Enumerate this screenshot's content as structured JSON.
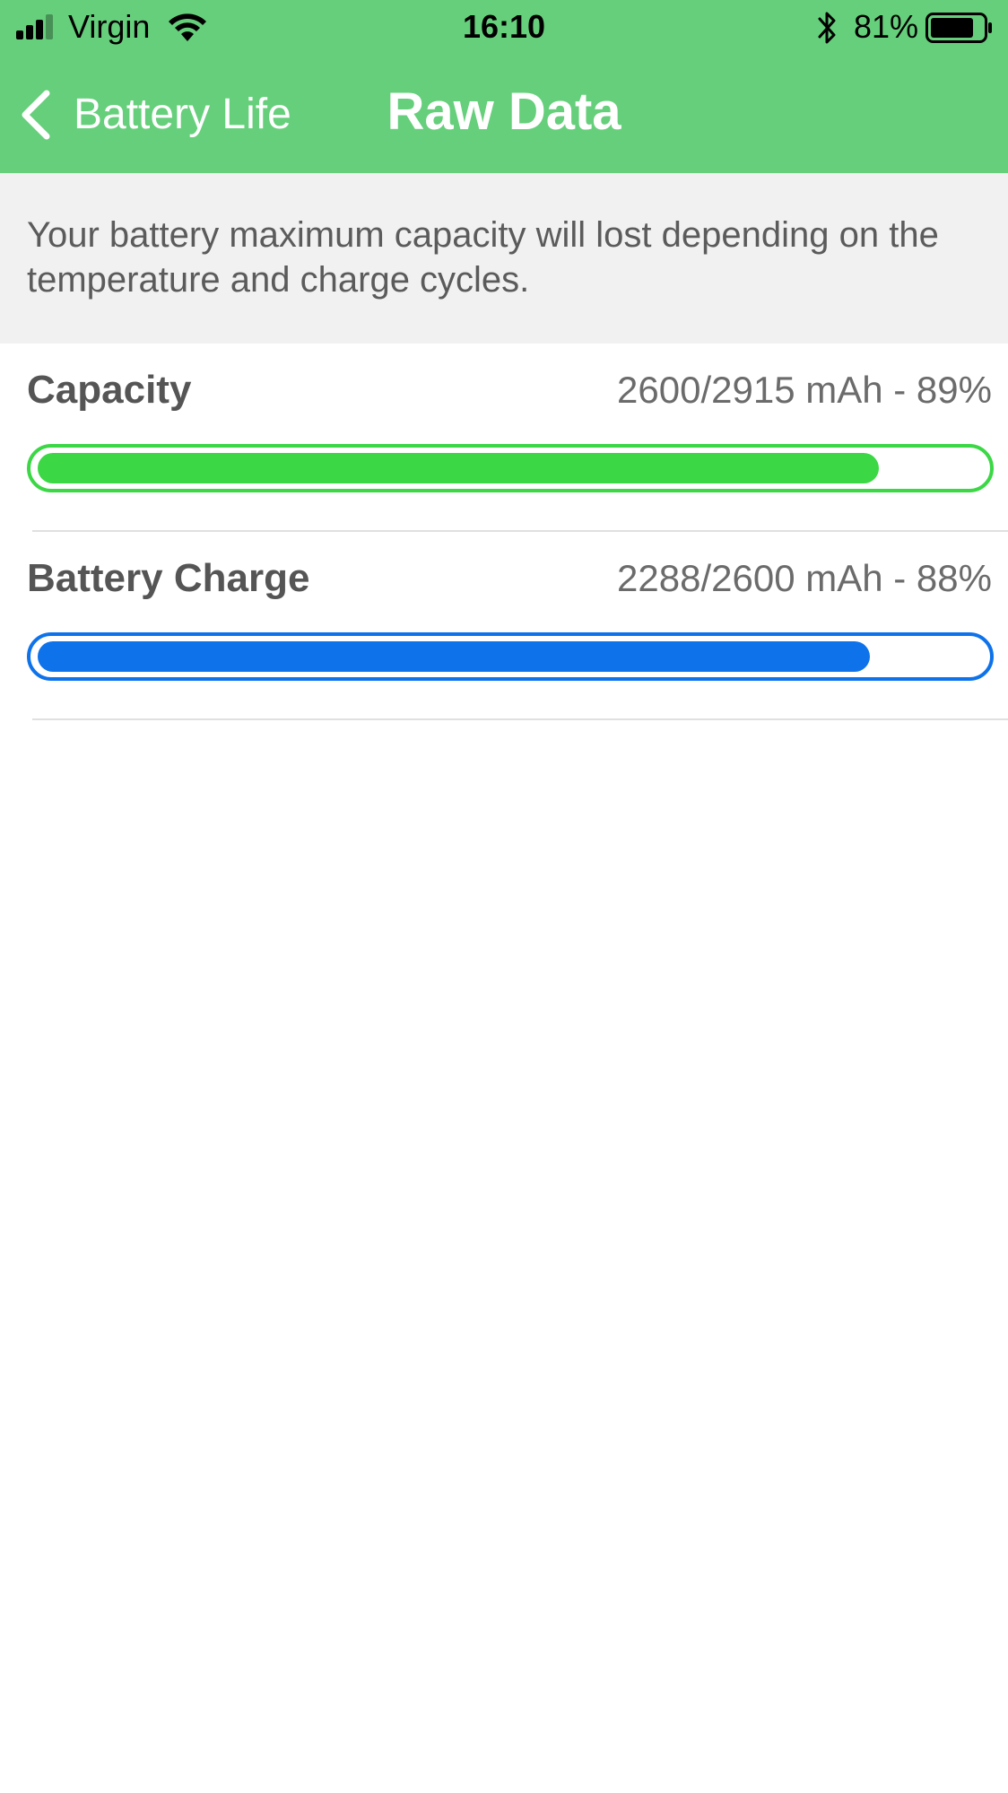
{
  "status_bar": {
    "carrier": "Virgin",
    "time": "16:10",
    "battery_percent": "81%",
    "signal_bars_filled": 3,
    "signal_bars_total": 4,
    "icons": [
      "signal-icon",
      "wifi-icon",
      "bluetooth-icon",
      "battery-icon"
    ]
  },
  "nav": {
    "back_label": "Battery Life",
    "title": "Raw Data",
    "back_icon": "chevron-left-icon"
  },
  "description": "Your battery maximum capacity will lost depending on the temperature and charge cycles.",
  "rows": [
    {
      "label": "Capacity",
      "value_text": "2600/2915 mAh - 89%",
      "fill_fraction": 0.89,
      "color": "#3BD745"
    },
    {
      "label": "Battery Charge",
      "value_text": "2288/2600 mAh - 88%",
      "fill_fraction": 0.88,
      "color": "#0E73EA"
    }
  ],
  "colors": {
    "header_background": "#66CF7B",
    "description_background": "#F1F1F1",
    "text_primary": "#555555",
    "text_secondary": "#6B6B6B"
  }
}
